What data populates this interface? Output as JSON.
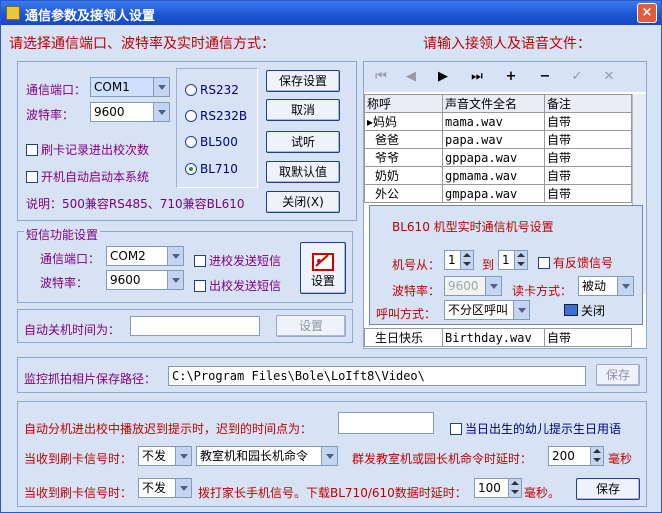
{
  "window": {
    "title": "通信参数及接领人设置",
    "close_label": "×"
  },
  "left_header": "请选择通信端口、波特率及实时通信方式：",
  "right_header": "请输入接领人及语音文件：",
  "comm": {
    "port_label": "通信端口：",
    "port_value": "COM1",
    "baud_label": "波特率：",
    "baud_value": "9600",
    "chk_record": "刷卡记录进出校次数",
    "chk_autostart": "开机自动启动本系统",
    "note": "说明：500兼容RS485、710兼容BL610",
    "radios": [
      "RS232",
      "RS232B",
      "BL500",
      "BL710"
    ],
    "selected_radio": "BL710",
    "buttons": {
      "save": "保存设置",
      "cancel": "取消",
      "listen": "试听",
      "default": "取默认值",
      "close": "关闭(X)"
    }
  },
  "sms": {
    "group_title": "短信功能设置",
    "port_label": "通信端口：",
    "port_value": "COM2",
    "baud_label": "波特率：",
    "baud_value": "9600",
    "chk_in": "进校发送短信",
    "chk_out": "出校发送短信",
    "settings_label": "设置"
  },
  "shutdown": {
    "label": "自动关机时间为：",
    "value": "",
    "button": "设置"
  },
  "grid": {
    "columns": [
      "称呼",
      "声音文件全名",
      "备注"
    ],
    "rows": [
      [
        "妈妈",
        "mama.wav",
        "自带"
      ],
      [
        "爸爸",
        "papa.wav",
        "自带"
      ],
      [
        "爷爷",
        "gppapa.wav",
        "自带"
      ],
      [
        "奶奶",
        "gpmama.wav",
        "自带"
      ],
      [
        "外公",
        "gmpapa.wav",
        "自带"
      ]
    ],
    "last_row": [
      "生日快乐",
      "Birthday.wav",
      "自带"
    ]
  },
  "popup": {
    "title": "BL610 机型实时通信机号设置",
    "from_label": "机号从：",
    "from_value": "1",
    "to_label": "到",
    "to_value": "1",
    "chk_feedback": "有反馈信号",
    "baud_label": "波特率：",
    "baud_value": "9600",
    "read_mode_label": "读卡方式：",
    "read_mode_value": "被动",
    "call_mode_label": "呼叫方式：",
    "call_mode_value": "不分区呼叫",
    "close_label": "关闭"
  },
  "photo": {
    "label": "监控抓拍相片保存路径：",
    "value": "C:\\Program Files\\Bole\\LoIft8\\Video\\",
    "button": "保存"
  },
  "bottom": {
    "late_label": "自动分机进出校中播放迟到提示时，迟到的时间点为：",
    "late_value": "",
    "chk_birthday": "当日出生的幼儿提示生日用语",
    "row2_label": "当收到刷卡信号时：",
    "row2_combo": "不发",
    "row2_combo2": "教室机和园长机命令",
    "row2_delay_label": "群发教室机或园长机命令时延时：",
    "row2_delay_value": "200",
    "row2_unit": "毫秒",
    "row3_label": "当收到刷卡信号时：",
    "row3_combo": "不发",
    "row3_text": "拨打家长手机信号。下载BL710/610数据时延时：",
    "row3_delay_value": "100",
    "row3_unit": "毫秒。",
    "save": "保存"
  }
}
